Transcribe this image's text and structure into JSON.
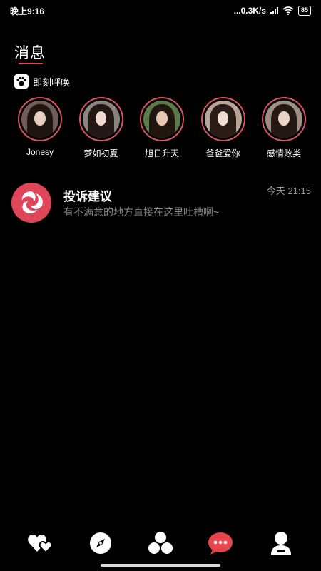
{
  "status_bar": {
    "time": "晚上9:16",
    "network_speed": "...0.3K/s",
    "battery": "85"
  },
  "page_title": "消息",
  "instant_call": {
    "label": "即刻呼唤",
    "icon": "paw-icon"
  },
  "avatars": [
    {
      "name": "Jonesy"
    },
    {
      "name": "梦如初夏"
    },
    {
      "name": "旭日升天"
    },
    {
      "name": "爸爸爱你"
    },
    {
      "name": "感情败类"
    }
  ],
  "messages": [
    {
      "title": "投诉建议",
      "preview": "有不满意的地方直接在这里吐槽啊~",
      "time": "今天 21:15"
    }
  ],
  "bottom_nav": [
    {
      "icon": "hearts-icon"
    },
    {
      "icon": "compass-icon"
    },
    {
      "icon": "clover-icon"
    },
    {
      "icon": "chat-bubble-icon",
      "active": true
    },
    {
      "icon": "profile-icon"
    }
  ],
  "colors": {
    "accent": "#e8444d",
    "background": "#000000",
    "muted_text": "#8a8a8a"
  }
}
